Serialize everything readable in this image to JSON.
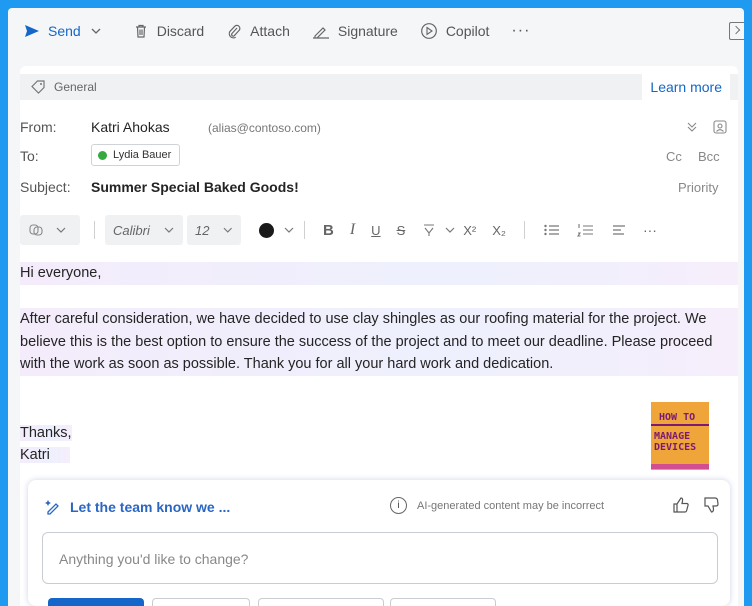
{
  "toolbar": {
    "send": "Send",
    "discard": "Discard",
    "attach": "Attach",
    "signature": "Signature",
    "copilot": "Copilot",
    "more": "···"
  },
  "header": {
    "sensitivity": "General",
    "learn_more": "Learn more",
    "from_label": "From:",
    "from_name": "Katri Ahokas",
    "from_alias": "(alias@contoso.com)",
    "to_label": "To:",
    "to_recipient": "Lydia Bauer",
    "cc": "Cc",
    "bcc": "Bcc",
    "subject_label": "Subject:",
    "subject": "Summer Special Baked Goods!",
    "priority": "Priority"
  },
  "format": {
    "font": "Calibri",
    "size": "12"
  },
  "body": {
    "greeting": "Hi everyone,",
    "paragraph": "After careful consideration, we have decided to use clay shingles as our roofing material for the project. We believe this is the best option to ensure the success of the project and to meet our deadline. Please proceed with the work as soon as possible.  Thank you for all your hard work and dedication.",
    "thanks": "Thanks,",
    "signoff": "Katri"
  },
  "watermark": {
    "line1": "HOW TO",
    "line2": "MANAGE DEVICES"
  },
  "copilot_panel": {
    "title": "Let the team know we ...",
    "disclaimer": "AI-generated content may be incorrect",
    "placeholder": "Anything you'd like to change?"
  }
}
